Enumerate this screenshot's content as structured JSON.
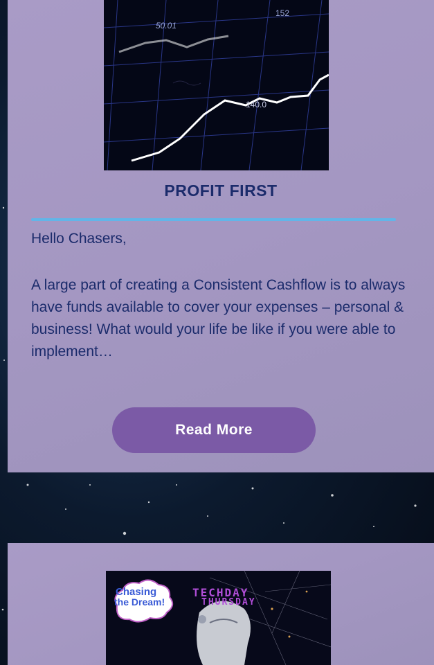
{
  "post1": {
    "thumb": {
      "label_left": "50.01",
      "label_right": "152",
      "label_mid": "140.0"
    },
    "title": "PROFIT FIRST",
    "greeting": "Hello Chasers,",
    "excerpt": "A large part of creating a Consistent Cashflow is to always have funds available to cover your expenses – personal & business! What would your life be like if you were able to implement…",
    "button_label": "Read More"
  },
  "post2": {
    "logo_line1": "Chasing",
    "logo_line2": "the Dream!",
    "banner_line1": "TECHDAY",
    "banner_line2": "THURSDAY"
  },
  "colors": {
    "card_bg": "#a99bc6",
    "title": "#1b2b6b",
    "divider": "#62b5e8",
    "button": "#7b5aa6"
  }
}
